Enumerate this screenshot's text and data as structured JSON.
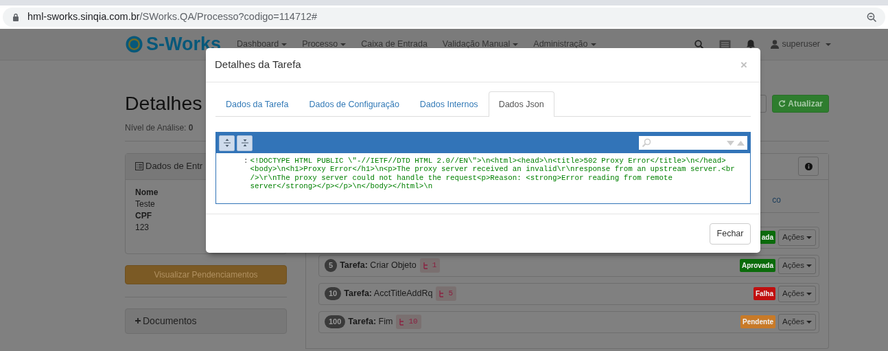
{
  "browser": {
    "url_host": "hml-sworks.sinqia.com.br",
    "url_path": "/SWorks.QA/Processo?codigo=114712#"
  },
  "navbar": {
    "brand": "S-Works",
    "items": [
      {
        "label": "Dashboard",
        "dropdown": true
      },
      {
        "label": "Processo",
        "dropdown": true
      },
      {
        "label": "Caixa de Entrada",
        "dropdown": false
      },
      {
        "label": "Validação Manual",
        "dropdown": true
      },
      {
        "label": "Administração",
        "dropdown": true
      }
    ],
    "user": "superuser"
  },
  "page": {
    "title": "Detalhes",
    "level_label": "Nível de Análise:",
    "level_value": "0",
    "refresh_button": "Atualizar",
    "input_panel": {
      "title": "Dados de Entr",
      "fields": [
        {
          "label": "Nome",
          "value": "Teste"
        },
        {
          "label": "CPF",
          "value": "123"
        }
      ]
    },
    "pending_button": "Visualizar Pendenciamentos",
    "documents_panel": "Documentos",
    "right_fragment": "co",
    "tasks": [
      {
        "status": "ada",
        "color": "#0b6b0b",
        "action": "Ações"
      },
      {
        "number": "5",
        "label": "Tarefa:",
        "name": "Criar Objeto",
        "ref": "1",
        "status": "Aprovada",
        "color": "#0b6b0b",
        "action": "Ações"
      },
      {
        "number": "10",
        "label": "Tarefa:",
        "name": "AcctTitleAddRq",
        "ref": "5",
        "status": "Falha",
        "color": "#c00f0f",
        "action": "Ações"
      },
      {
        "number": "100",
        "label": "Tarefa:",
        "name": "Fim",
        "ref": "10",
        "status": "Pendente",
        "color": "#c87a28",
        "action": "Ações"
      }
    ]
  },
  "modal": {
    "title": "Detalhes da Tarefa",
    "close": "×",
    "tabs": [
      {
        "label": "Dados da Tarefa",
        "selected": false
      },
      {
        "label": "Dados de Configuração",
        "selected": false
      },
      {
        "label": "Dados Internos",
        "selected": false
      },
      {
        "label": "Dados Json",
        "selected": true
      }
    ],
    "editor": {
      "separator": ":",
      "lines": [
        "<!DOCTYPE HTML PUBLIC \\\"-//IETF//DTD HTML 2.0//EN\\\">\\n<html><head>\\n<title>502 Proxy Error</title>\\n</head>",
        "<body>\\n<h1>Proxy Error</h1>\\n<p>The proxy server received an invalid\\r\\nresponse from an upstream server.<br",
        "/>\\r\\nThe proxy server could not handle the request<p>Reason: <strong>Error reading from remote",
        "server</strong></p></p>\\n</body></html>\\n"
      ]
    },
    "close_button": "Fechar"
  }
}
